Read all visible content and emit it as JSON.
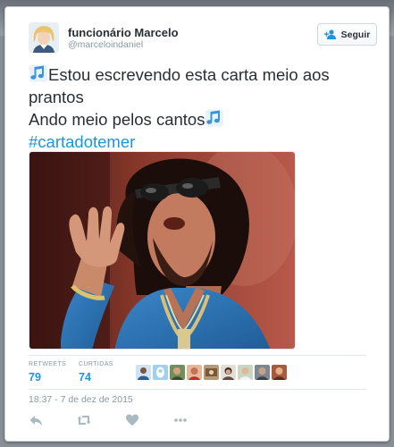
{
  "tweet": {
    "author_name": "funcionário Marcelo",
    "handle": "@marceloindaniel",
    "follow_label": "Seguir",
    "text_line1": "Estou escrevendo esta carta meio aos",
    "text_line2": "prantos",
    "text_line3": "Ando meio pelos cantos",
    "hashtag": "#cartadotemer",
    "timestamp": "18:37 - 7 de dez de 2015"
  },
  "stats": {
    "retweets_label": "RETWEETS",
    "retweets_value": "79",
    "likes_label": "CURTIDAS",
    "likes_value": "74"
  },
  "liker_avatars": [
    "avatar-1",
    "avatar-2",
    "avatar-3",
    "avatar-4",
    "avatar-5",
    "avatar-6",
    "avatar-7",
    "avatar-8",
    "avatar-9"
  ],
  "actions": [
    "reply-icon",
    "retweet-icon",
    "like-icon",
    "more-icon"
  ],
  "colors": {
    "link": "#1b95e0",
    "muted": "#8899a6",
    "text": "#292f33",
    "note_emoji": "#3b94d9"
  }
}
